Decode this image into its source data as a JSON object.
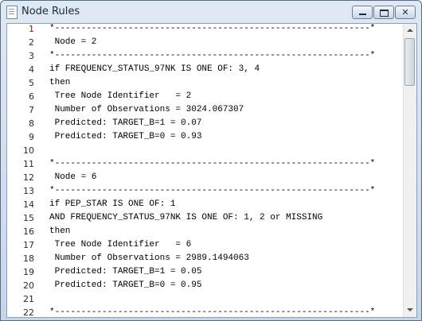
{
  "window": {
    "title": "Node Rules",
    "icon": "document-icon",
    "minimize_label": "",
    "maximize_label": "",
    "close_label": "✕"
  },
  "editor": {
    "current_line": 1,
    "line_numbers": [
      "1",
      "2",
      "3",
      "4",
      "5",
      "6",
      "7",
      "8",
      "9",
      "10",
      "11",
      "12",
      "13",
      "14",
      "15",
      "16",
      "17",
      "18",
      "19",
      "20",
      "21",
      "22"
    ],
    "lines": [
      "*------------------------------------------------------------*",
      " Node = 2",
      "*------------------------------------------------------------*",
      "if FREQUENCY_STATUS_97NK IS ONE OF: 3, 4",
      "then",
      " Tree Node Identifier   = 2",
      " Number of Observations = 3024.067307",
      " Predicted: TARGET_B=1 = 0.07",
      " Predicted: TARGET_B=0 = 0.93",
      "",
      "*------------------------------------------------------------*",
      " Node = 6",
      "*------------------------------------------------------------*",
      "if PEP_STAR IS ONE OF: 1",
      "AND FREQUENCY_STATUS_97NK IS ONE OF: 1, 2 or MISSING",
      "then",
      " Tree Node Identifier   = 6",
      " Number of Observations = 2989.1494063",
      " Predicted: TARGET_B=1 = 0.05",
      " Predicted: TARGET_B=0 = 0.95",
      "",
      "*------------------------------------------------------------*"
    ]
  }
}
